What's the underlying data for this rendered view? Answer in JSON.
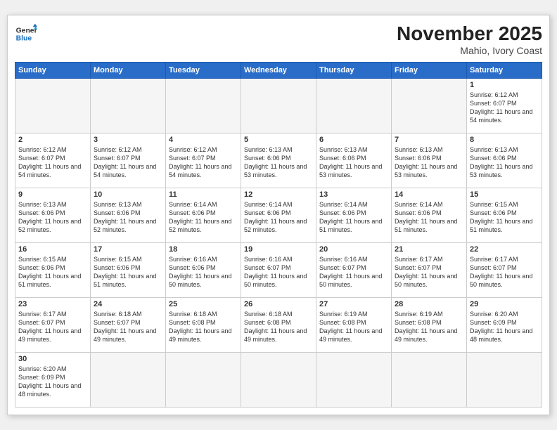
{
  "header": {
    "logo_general": "General",
    "logo_blue": "Blue",
    "month_title": "November 2025",
    "location": "Mahio, Ivory Coast"
  },
  "weekdays": [
    "Sunday",
    "Monday",
    "Tuesday",
    "Wednesday",
    "Thursday",
    "Friday",
    "Saturday"
  ],
  "weeks": [
    [
      {
        "day": null
      },
      {
        "day": null
      },
      {
        "day": null
      },
      {
        "day": null
      },
      {
        "day": null
      },
      {
        "day": null
      },
      {
        "day": "1",
        "sunrise": "6:12 AM",
        "sunset": "6:07 PM",
        "daylight": "11 hours and 54 minutes."
      }
    ],
    [
      {
        "day": "2",
        "sunrise": "6:12 AM",
        "sunset": "6:07 PM",
        "daylight": "11 hours and 54 minutes."
      },
      {
        "day": "3",
        "sunrise": "6:12 AM",
        "sunset": "6:07 PM",
        "daylight": "11 hours and 54 minutes."
      },
      {
        "day": "4",
        "sunrise": "6:12 AM",
        "sunset": "6:07 PM",
        "daylight": "11 hours and 54 minutes."
      },
      {
        "day": "5",
        "sunrise": "6:13 AM",
        "sunset": "6:06 PM",
        "daylight": "11 hours and 53 minutes."
      },
      {
        "day": "6",
        "sunrise": "6:13 AM",
        "sunset": "6:06 PM",
        "daylight": "11 hours and 53 minutes."
      },
      {
        "day": "7",
        "sunrise": "6:13 AM",
        "sunset": "6:06 PM",
        "daylight": "11 hours and 53 minutes."
      },
      {
        "day": "8",
        "sunrise": "6:13 AM",
        "sunset": "6:06 PM",
        "daylight": "11 hours and 53 minutes."
      }
    ],
    [
      {
        "day": "9",
        "sunrise": "6:13 AM",
        "sunset": "6:06 PM",
        "daylight": "11 hours and 52 minutes."
      },
      {
        "day": "10",
        "sunrise": "6:13 AM",
        "sunset": "6:06 PM",
        "daylight": "11 hours and 52 minutes."
      },
      {
        "day": "11",
        "sunrise": "6:14 AM",
        "sunset": "6:06 PM",
        "daylight": "11 hours and 52 minutes."
      },
      {
        "day": "12",
        "sunrise": "6:14 AM",
        "sunset": "6:06 PM",
        "daylight": "11 hours and 52 minutes."
      },
      {
        "day": "13",
        "sunrise": "6:14 AM",
        "sunset": "6:06 PM",
        "daylight": "11 hours and 51 minutes."
      },
      {
        "day": "14",
        "sunrise": "6:14 AM",
        "sunset": "6:06 PM",
        "daylight": "11 hours and 51 minutes."
      },
      {
        "day": "15",
        "sunrise": "6:15 AM",
        "sunset": "6:06 PM",
        "daylight": "11 hours and 51 minutes."
      }
    ],
    [
      {
        "day": "16",
        "sunrise": "6:15 AM",
        "sunset": "6:06 PM",
        "daylight": "11 hours and 51 minutes."
      },
      {
        "day": "17",
        "sunrise": "6:15 AM",
        "sunset": "6:06 PM",
        "daylight": "11 hours and 51 minutes."
      },
      {
        "day": "18",
        "sunrise": "6:16 AM",
        "sunset": "6:06 PM",
        "daylight": "11 hours and 50 minutes."
      },
      {
        "day": "19",
        "sunrise": "6:16 AM",
        "sunset": "6:07 PM",
        "daylight": "11 hours and 50 minutes."
      },
      {
        "day": "20",
        "sunrise": "6:16 AM",
        "sunset": "6:07 PM",
        "daylight": "11 hours and 50 minutes."
      },
      {
        "day": "21",
        "sunrise": "6:17 AM",
        "sunset": "6:07 PM",
        "daylight": "11 hours and 50 minutes."
      },
      {
        "day": "22",
        "sunrise": "6:17 AM",
        "sunset": "6:07 PM",
        "daylight": "11 hours and 50 minutes."
      }
    ],
    [
      {
        "day": "23",
        "sunrise": "6:17 AM",
        "sunset": "6:07 PM",
        "daylight": "11 hours and 49 minutes."
      },
      {
        "day": "24",
        "sunrise": "6:18 AM",
        "sunset": "6:07 PM",
        "daylight": "11 hours and 49 minutes."
      },
      {
        "day": "25",
        "sunrise": "6:18 AM",
        "sunset": "6:08 PM",
        "daylight": "11 hours and 49 minutes."
      },
      {
        "day": "26",
        "sunrise": "6:18 AM",
        "sunset": "6:08 PM",
        "daylight": "11 hours and 49 minutes."
      },
      {
        "day": "27",
        "sunrise": "6:19 AM",
        "sunset": "6:08 PM",
        "daylight": "11 hours and 49 minutes."
      },
      {
        "day": "28",
        "sunrise": "6:19 AM",
        "sunset": "6:08 PM",
        "daylight": "11 hours and 49 minutes."
      },
      {
        "day": "29",
        "sunrise": "6:20 AM",
        "sunset": "6:09 PM",
        "daylight": "11 hours and 48 minutes."
      }
    ],
    [
      {
        "day": "30",
        "sunrise": "6:20 AM",
        "sunset": "6:09 PM",
        "daylight": "11 hours and 48 minutes."
      },
      {
        "day": null
      },
      {
        "day": null
      },
      {
        "day": null
      },
      {
        "day": null
      },
      {
        "day": null
      },
      {
        "day": null
      }
    ]
  ]
}
